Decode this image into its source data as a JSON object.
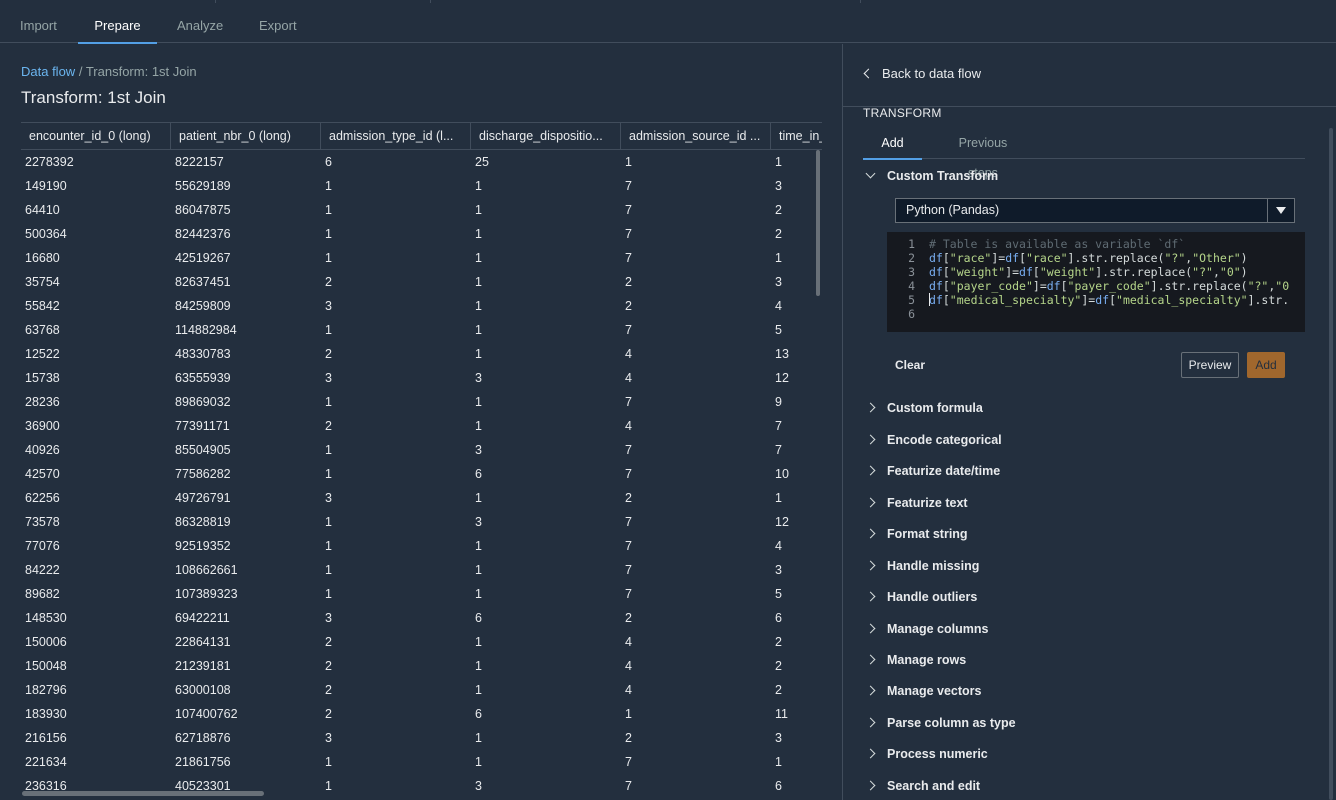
{
  "top_tabs": [
    {
      "label": "Import",
      "active": false
    },
    {
      "label": "Prepare",
      "active": true
    },
    {
      "label": "Analyze",
      "active": false
    },
    {
      "label": "Export",
      "active": false
    }
  ],
  "breadcrumb": {
    "root": "Data flow",
    "separator": "/",
    "current": "Transform: 1st Join"
  },
  "page_title": "Transform: 1st Join",
  "table": {
    "columns": [
      "encounter_id_0 (long)",
      "patient_nbr_0 (long)",
      "admission_type_id (l...",
      "discharge_dispositio...",
      "admission_source_id ...",
      "time_in_"
    ],
    "rows": [
      [
        "2278392",
        "8222157",
        "6",
        "25",
        "1",
        "1"
      ],
      [
        "149190",
        "55629189",
        "1",
        "1",
        "7",
        "3"
      ],
      [
        "64410",
        "86047875",
        "1",
        "1",
        "7",
        "2"
      ],
      [
        "500364",
        "82442376",
        "1",
        "1",
        "7",
        "2"
      ],
      [
        "16680",
        "42519267",
        "1",
        "1",
        "7",
        "1"
      ],
      [
        "35754",
        "82637451",
        "2",
        "1",
        "2",
        "3"
      ],
      [
        "55842",
        "84259809",
        "3",
        "1",
        "2",
        "4"
      ],
      [
        "63768",
        "114882984",
        "1",
        "1",
        "7",
        "5"
      ],
      [
        "12522",
        "48330783",
        "2",
        "1",
        "4",
        "13"
      ],
      [
        "15738",
        "63555939",
        "3",
        "3",
        "4",
        "12"
      ],
      [
        "28236",
        "89869032",
        "1",
        "1",
        "7",
        "9"
      ],
      [
        "36900",
        "77391171",
        "2",
        "1",
        "4",
        "7"
      ],
      [
        "40926",
        "85504905",
        "1",
        "3",
        "7",
        "7"
      ],
      [
        "42570",
        "77586282",
        "1",
        "6",
        "7",
        "10"
      ],
      [
        "62256",
        "49726791",
        "3",
        "1",
        "2",
        "1"
      ],
      [
        "73578",
        "86328819",
        "1",
        "3",
        "7",
        "12"
      ],
      [
        "77076",
        "92519352",
        "1",
        "1",
        "7",
        "4"
      ],
      [
        "84222",
        "108662661",
        "1",
        "1",
        "7",
        "3"
      ],
      [
        "89682",
        "107389323",
        "1",
        "1",
        "7",
        "5"
      ],
      [
        "148530",
        "69422211",
        "3",
        "6",
        "2",
        "6"
      ],
      [
        "150006",
        "22864131",
        "2",
        "1",
        "4",
        "2"
      ],
      [
        "150048",
        "21239181",
        "2",
        "1",
        "4",
        "2"
      ],
      [
        "182796",
        "63000108",
        "2",
        "1",
        "4",
        "2"
      ],
      [
        "183930",
        "107400762",
        "2",
        "6",
        "1",
        "11"
      ],
      [
        "216156",
        "62718876",
        "3",
        "1",
        "2",
        "3"
      ],
      [
        "221634",
        "21861756",
        "1",
        "1",
        "7",
        "1"
      ],
      [
        "236316",
        "40523301",
        "1",
        "3",
        "7",
        "6"
      ]
    ]
  },
  "panel": {
    "back_label": "Back to data flow",
    "section_title": "TRANSFORM",
    "subtabs": [
      {
        "label": "Add",
        "active": true
      },
      {
        "label": "Previous steps",
        "active": false
      }
    ],
    "custom_transform": {
      "label": "Custom Transform",
      "language": "Python (Pandas)",
      "code_lines": [
        [
          {
            "t": "c",
            "s": "# Table is available as variable `df`"
          }
        ],
        [
          {
            "t": "v",
            "s": "df"
          },
          {
            "t": "p",
            "s": "["
          },
          {
            "t": "s",
            "s": "\"race\""
          },
          {
            "t": "p",
            "s": "]="
          },
          {
            "t": "v",
            "s": "df"
          },
          {
            "t": "p",
            "s": "["
          },
          {
            "t": "s",
            "s": "\"race\""
          },
          {
            "t": "p",
            "s": "].str.replace("
          },
          {
            "t": "s",
            "s": "\"?\""
          },
          {
            "t": "p",
            "s": ","
          },
          {
            "t": "s",
            "s": "\"Other\""
          },
          {
            "t": "p",
            "s": ")"
          }
        ],
        [
          {
            "t": "v",
            "s": "df"
          },
          {
            "t": "p",
            "s": "["
          },
          {
            "t": "s",
            "s": "\"weight\""
          },
          {
            "t": "p",
            "s": "]="
          },
          {
            "t": "v",
            "s": "df"
          },
          {
            "t": "p",
            "s": "["
          },
          {
            "t": "s",
            "s": "\"weight\""
          },
          {
            "t": "p",
            "s": "].str.replace("
          },
          {
            "t": "s",
            "s": "\"?\""
          },
          {
            "t": "p",
            "s": ","
          },
          {
            "t": "s",
            "s": "\"0\""
          },
          {
            "t": "p",
            "s": ")"
          }
        ],
        [
          {
            "t": "v",
            "s": "df"
          },
          {
            "t": "p",
            "s": "["
          },
          {
            "t": "s",
            "s": "\"payer_code\""
          },
          {
            "t": "p",
            "s": "]="
          },
          {
            "t": "v",
            "s": "df"
          },
          {
            "t": "p",
            "s": "["
          },
          {
            "t": "s",
            "s": "\"payer_code\""
          },
          {
            "t": "p",
            "s": "].str.replace("
          },
          {
            "t": "s",
            "s": "\"?\""
          },
          {
            "t": "p",
            "s": ","
          },
          {
            "t": "s",
            "s": "\"0"
          }
        ],
        [
          {
            "t": "v",
            "s": "df"
          },
          {
            "t": "p",
            "s": "["
          },
          {
            "t": "s",
            "s": "\"medical_specialty\""
          },
          {
            "t": "p",
            "s": "]="
          },
          {
            "t": "v",
            "s": "df"
          },
          {
            "t": "p",
            "s": "["
          },
          {
            "t": "s",
            "s": "\"medical_specialty\""
          },
          {
            "t": "p",
            "s": "].str."
          }
        ],
        []
      ],
      "clear_label": "Clear",
      "preview_label": "Preview",
      "add_label": "Add"
    },
    "transforms": [
      "Custom formula",
      "Encode categorical",
      "Featurize date/time",
      "Featurize text",
      "Format string",
      "Handle missing",
      "Handle outliers",
      "Manage columns",
      "Manage rows",
      "Manage vectors",
      "Parse column as type",
      "Process numeric",
      "Search and edit"
    ]
  },
  "colors": {
    "background": "#232f3e",
    "accent": "#539fe5",
    "link": "#6bb5ef",
    "primary_button": "#a0672d",
    "border": "#414d5c"
  }
}
